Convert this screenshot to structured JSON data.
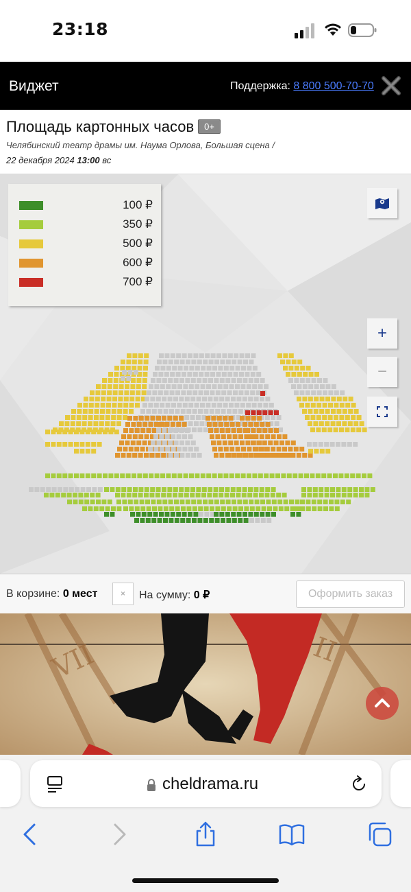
{
  "status_bar": {
    "time": "23:18"
  },
  "widget": {
    "title": "Виджет",
    "support_label": "Поддержка:",
    "support_phone": "8 800 500-70-70"
  },
  "event": {
    "title": "Площадь картонных часов",
    "age": "0+",
    "venue": "Челябинский театр драмы им. Наума Орлова, Большая сцена /",
    "date": "22 декабря 2024",
    "time": "13:00",
    "weekday": "вс"
  },
  "legend": [
    {
      "price": "100 ₽",
      "color": "#3e8e2a"
    },
    {
      "price": "350 ₽",
      "color": "#a5cc3d"
    },
    {
      "price": "500 ₽",
      "color": "#e6c93b"
    },
    {
      "price": "600 ₽",
      "color": "#e0952f"
    },
    {
      "price": "700 ₽",
      "color": "#c92e26"
    }
  ],
  "seat_colors": {
    "taken": "#c9c9c9",
    "p100": "#3e8e2a",
    "p350": "#a5cc3d",
    "p500": "#e6c93b",
    "p600": "#e0952f",
    "p700": "#c92e26"
  },
  "map_controls": {
    "zoom_in": "+",
    "zoom_out": "−"
  },
  "cart": {
    "label": "В корзине:",
    "count": "0 мест",
    "clear": "×",
    "sum_label": "На сумму:",
    "sum": "0 ₽",
    "order_button": "Оформить заказ"
  },
  "browser": {
    "url": "cheldrama.ru"
  }
}
